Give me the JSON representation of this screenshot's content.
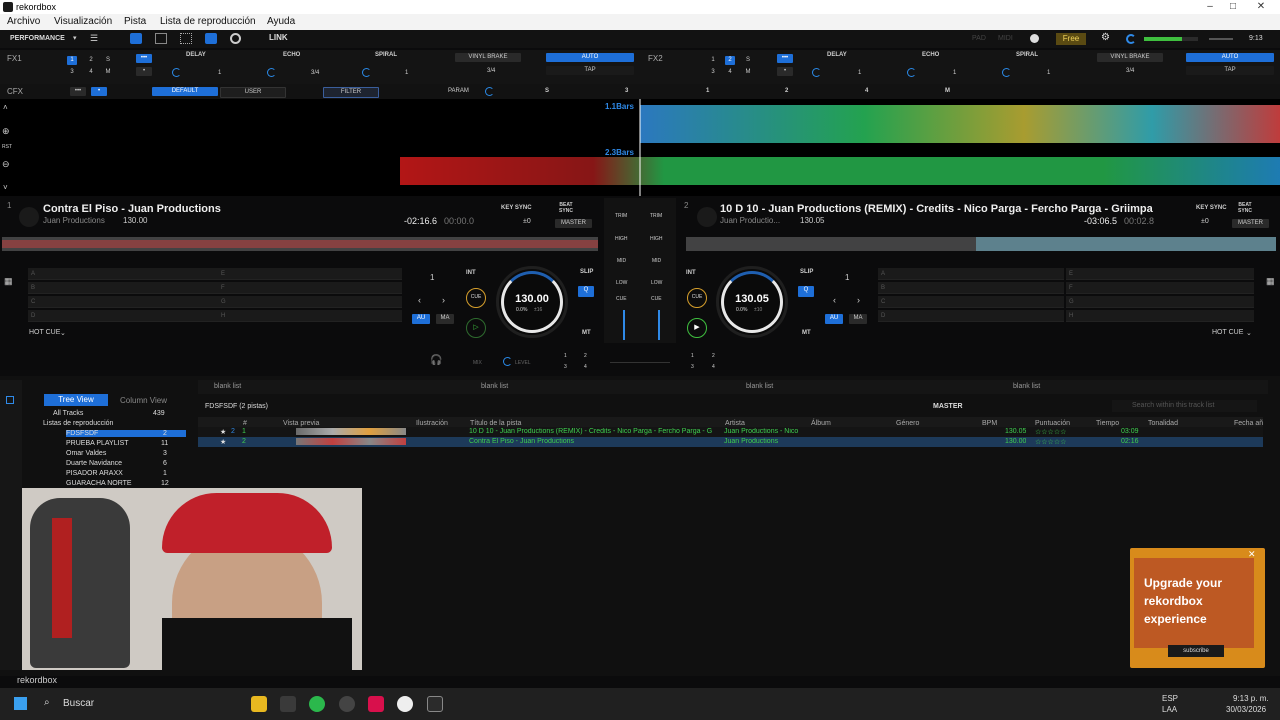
{
  "window": {
    "title": "rekordbox",
    "min": "–",
    "max": "□",
    "close": "✕"
  },
  "menu": [
    "Archivo",
    "Visualización",
    "Pista",
    "Lista de reproducción",
    "Ayuda"
  ],
  "toolbar": {
    "mode": "PERFORMANCE",
    "link": "LINK",
    "pad": "PAD",
    "midi": "MIDI",
    "free": "Free",
    "time": "9:13"
  },
  "fx1": {
    "label": "FX1",
    "nums": [
      "1",
      "2",
      "S",
      "3",
      "4",
      "M"
    ],
    "effects": [
      "DELAY",
      "ECHO",
      "SPIRAL"
    ],
    "vals": [
      "1",
      "3/4",
      "1"
    ],
    "vinyl": "VINYL BRAKE",
    "beat": "3/4",
    "auto": "AUTO",
    "tap": "TAP"
  },
  "fx2": {
    "label": "FX2",
    "nums": [
      "1",
      "2",
      "S",
      "3",
      "4",
      "M"
    ],
    "effects": [
      "DELAY",
      "ECHO",
      "SPIRAL"
    ],
    "vals": [
      "1",
      "1",
      "1"
    ],
    "vinyl": "VINYL BRAKE",
    "beat": "3/4",
    "auto": "AUTO",
    "tap": "TAP"
  },
  "cfx": {
    "label": "CFX",
    "default": "DEFAULT",
    "user": "USER",
    "filter": "FILTER",
    "param": "PARAM",
    "s": "S",
    "nums": [
      "3",
      "1",
      "2",
      "4",
      "M"
    ]
  },
  "wave": {
    "rst": "RST",
    "bars1": "1.1Bars",
    "bars2": "2.3Bars"
  },
  "deck1": {
    "num": "1",
    "title": "Contra El Piso - Juan Productions",
    "artist": "Juan Productions",
    "bpm_sm": "130.00",
    "time": "-02:16.6",
    "time2": "00:00.0",
    "keysync": "KEY SYNC",
    "beatsync": "BEAT SYNC",
    "master": "MASTER",
    "key": "±0",
    "bpm": "130.00",
    "pitch": "0.0%",
    "pitch2": "±16",
    "int": "INT",
    "slip": "SLIP",
    "q": "Q",
    "cue": "CUE",
    "au": "AU",
    "ma": "MA",
    "mt": "MT",
    "beatjump": "1",
    "hotcue": "HOT CUE",
    "pads": [
      "A",
      "B",
      "C",
      "D",
      "E",
      "F",
      "G",
      "H"
    ]
  },
  "deck2": {
    "num": "2",
    "title": "10 D 10 - Juan Productions (REMIX) - Credits - Nico Parga - Fercho Parga - Griimpa",
    "artist": "Juan Productio...",
    "bpm_sm": "130.05",
    "time": "-03:06.5",
    "time2": "00:02.8",
    "keysync": "KEY SYNC",
    "beatsync": "BEAT SYNC",
    "master": "MASTER",
    "key": "±0",
    "bpm": "130.05",
    "pitch": "0.0%",
    "pitch2": "±10",
    "int": "INT",
    "slip": "SLIP",
    "q": "Q",
    "cue": "CUE",
    "au": "AU",
    "ma": "MA",
    "mt": "MT",
    "beatjump": "1",
    "hotcue": "HOT CUE",
    "pads": [
      "A",
      "B",
      "C",
      "D",
      "E",
      "F",
      "G",
      "H"
    ]
  },
  "mixer": {
    "trim": "TRIM",
    "high": "HIGH",
    "mid": "MID",
    "low": "LOW",
    "cue": "CUE",
    "mix": "MIX",
    "level": "LEVEL",
    "nums": [
      "1",
      "2",
      "3",
      "4"
    ]
  },
  "browser": {
    "tabs": [
      "blank list",
      "blank list",
      "blank list",
      "blank list"
    ],
    "treeview": "Tree View",
    "columnview": "Column View",
    "alltracks": "All Tracks",
    "alltracks_count": "439",
    "playlists_label": "Listas de reproducción",
    "playlists": [
      {
        "name": "FDSFSDF",
        "count": "2"
      },
      {
        "name": "PRUEBA PLAYLIST",
        "count": "11"
      },
      {
        "name": "Omar Valdes",
        "count": "3"
      },
      {
        "name": "Duarte Navidance",
        "count": "6"
      },
      {
        "name": "PISADOR ARAXX",
        "count": "1"
      },
      {
        "name": "GUARACHA NORTE",
        "count": "12"
      }
    ],
    "listtitle": "FDSFSDF (2 pistas)",
    "master": "MASTER",
    "search": "Search within this track list",
    "columns": [
      "#",
      "Vista previa",
      "Ilustración",
      "Título de la pista",
      "Artista",
      "Álbum",
      "Género",
      "BPM",
      "Puntuación",
      "Tiempo",
      "Tonalidad",
      "Fecha añ"
    ],
    "rows": [
      {
        "num": "1",
        "deck": "2",
        "title": "10 D 10 - Juan Productions (REMIX) - Credits - Nico Parga - Fercho Parga - G",
        "artist": "Juan Productions - Nico",
        "bpm": "130.05",
        "time": "03:09"
      },
      {
        "num": "2",
        "deck": "1",
        "title": "Contra El Piso - Juan Productions",
        "artist": "Juan Productions",
        "bpm": "130.00",
        "time": "02:16"
      }
    ]
  },
  "ad": {
    "text": "Upgrade your rekordbox experience",
    "btn": "subscribe"
  },
  "brand": "rekordbox",
  "taskbar": {
    "search": "Buscar",
    "lang": "ESP",
    "lang2": "LAA",
    "time": "9:13 p. m.",
    "date": "30/03/2026"
  },
  "colors": {
    "accent": "#1e6fd8",
    "cue": "#d69f2c",
    "play": "#3fbf3f",
    "bars": "#2f8ae8"
  }
}
